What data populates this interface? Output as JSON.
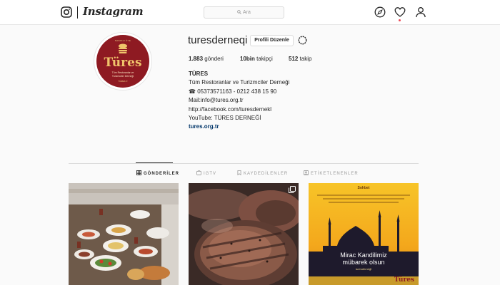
{
  "nav": {
    "wordmark": "Instagram",
    "search_placeholder": "Ara"
  },
  "profile": {
    "username": "turesderneqi",
    "edit_button": "Profili Düzenle",
    "avatar": {
      "small_text": "SAVAKLI ÜYE",
      "brand": "Türes",
      "sub_line1": "Tüm Restoranlar ve",
      "sub_line2": "Turizmciler Derneği",
      "bottom_text": "TÜRES ©"
    },
    "stats": {
      "posts_count": "1.883",
      "posts_label": "gönderi",
      "followers_count": "10bin",
      "followers_label": "takipçi",
      "following_count": "512",
      "following_label": "takip"
    },
    "bio": {
      "name": "TÜRES",
      "line1": "Tüm Restoranlar ve Turizmciler Derneği",
      "line2": "☎ 05373571163 - 0212 438 15 90",
      "line3": "Mail:info@tures.org.tr",
      "line4": "http://facebook.com/turesdernekl",
      "line5": "YouTube: TÜRES DERNEĞİ",
      "website": "tures.org.tr"
    }
  },
  "tabs": [
    {
      "label": "GÖNDERİLER",
      "icon": "grid-icon",
      "active": true
    },
    {
      "label": "IGTV",
      "icon": "igtv-icon",
      "active": false
    },
    {
      "label": "KAYDEDİLENLER",
      "icon": "bookmark-icon",
      "active": false
    },
    {
      "label": "ETİKETLENENLER",
      "icon": "tag-icon",
      "active": false
    }
  ],
  "posts": [
    {
      "description": "breakfast-table-photo"
    },
    {
      "description": "grilled-meat-photo",
      "badge": "multiple-photos-icon"
    },
    {
      "description": "mirac-kandili-greeting",
      "header": "Sohbet",
      "title_line1": "Mirac Kandilimiz",
      "title_line2": "mübarek olsun",
      "signature": "turesderneği",
      "footer_brand": "Türes"
    }
  ],
  "colors": {
    "accent_link": "#003569",
    "notification_dot": "#ed4956",
    "avatar_background": "#8e1a22",
    "avatar_gold": "#f0c46b"
  }
}
